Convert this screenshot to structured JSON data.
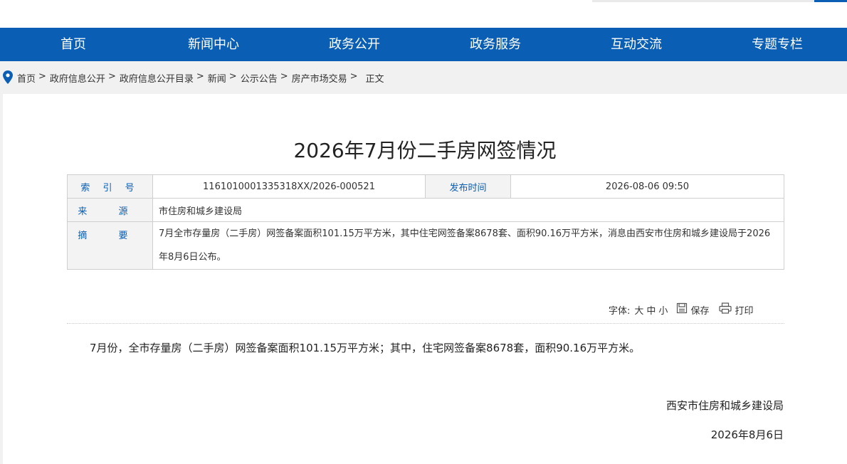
{
  "nav": {
    "items": [
      "首页",
      "新闻中心",
      "政务公开",
      "政务服务",
      "互动交流",
      "专题专栏"
    ]
  },
  "breadcrumb": {
    "items": [
      "首页",
      "政府信息公开",
      "政府信息公开目录",
      "新闻",
      "公示公告",
      "房产市场交易",
      "正文"
    ],
    "separator": ">"
  },
  "article": {
    "title": "2026年7月份二手房网签情况",
    "meta": {
      "index_label": "索 引 号",
      "index_value": "1161010001335318XX/2026-000521",
      "publish_label": "发布时间",
      "publish_value": "2026-08-06 09:50",
      "source_label": "来 源",
      "source_value": "市住房和城乡建设局",
      "summary_label": "摘 要",
      "summary_value": "7月全市存量房（二手房）网签备案面积101.15万平方米，其中住宅网签备案8678套、面积90.16万平方米，消息由西安市住房和城乡建设局于2026年8月6日公布。"
    },
    "tools": {
      "font_label": "字体:",
      "size_large": "大",
      "size_medium": "中",
      "size_small": "小",
      "save_label": "保存",
      "print_label": "打印"
    },
    "body": "7月份，全市存量房（二手房）网签备案面积101.15万平方米；其中，住宅网签备案8678套，面积90.16万平方米。",
    "signature_org": "西安市住房和城乡建设局",
    "signature_date": "2026年8月6日"
  },
  "colors": {
    "nav_bg": "#0a5fb4",
    "label_text": "#0a5fb4",
    "page_bg": "#f1f1f1"
  },
  "icons": [
    "location-pin-icon",
    "save-icon",
    "print-icon"
  ]
}
